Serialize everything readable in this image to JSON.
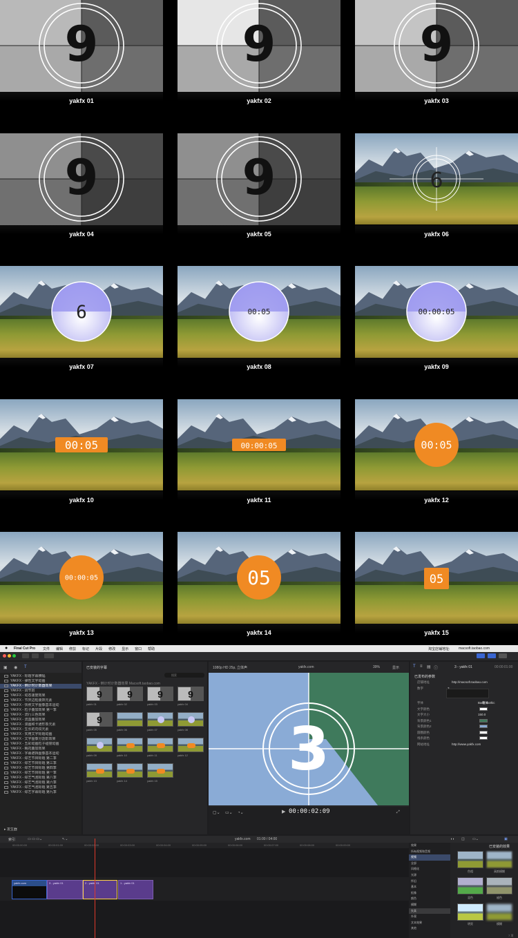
{
  "grid": {
    "items": [
      {
        "label": "yakfx 01",
        "digit": "9"
      },
      {
        "label": "yakfx 02",
        "digit": "9"
      },
      {
        "label": "yakfx 03",
        "digit": "9"
      },
      {
        "label": "yakfx 04",
        "digit": "9"
      },
      {
        "label": "yakfx 05",
        "digit": "9"
      },
      {
        "label": "yakfx 06",
        "digit": "6"
      },
      {
        "label": "yakfx 07",
        "digit": "6"
      },
      {
        "label": "yakfx 08",
        "digit": "00:05"
      },
      {
        "label": "yakfx 09",
        "digit": "00:00:05"
      },
      {
        "label": "yakfx 10",
        "digit": "00:05"
      },
      {
        "label": "yakfx 11",
        "digit": "00:00:05"
      },
      {
        "label": "yakfx 12",
        "digit": "00:05"
      },
      {
        "label": "yakfx 13",
        "digit": "00:00:05"
      },
      {
        "label": "yakfx 14",
        "digit": "05"
      },
      {
        "label": "yakfx 15",
        "digit": "05"
      }
    ]
  },
  "fcp": {
    "app_name": "Final Cut Pro",
    "menus": [
      "文件",
      "编辑",
      "修剪",
      "标记",
      "片段",
      "修改",
      "显示",
      "窗口",
      "帮助"
    ],
    "store_label": "淘宝店铺地址:",
    "store_url": "macsoft.taobao.com",
    "browser_header": "已安装的字幕",
    "search_placeholder": "搜索",
    "browser_group": "YAKFX - 倒计时计数器效果 Macsoft.taobao.com",
    "sidebar": [
      "YAKFX - 标题字幕横幅",
      "YAKFX - 弹性文字动画",
      "YAKFX - 倒计时计数器效果",
      "YAKFX - 调节层",
      "YAKFX - 动态速度效果",
      "YAKFX - 节庆边框装饰元素",
      "YAKFX - 快照文字图像基本运动",
      "YAKFX - 粒子叠加效果 第一季",
      "YAKFX - 流行三色效果",
      "YAKFX - 流血叠加效果",
      "YAKFX - 漫画和卡通形象元素",
      "YAKFX - 生长的花纹元素",
      "YAKFX - 实用文字标题动画",
      "YAKFX - 文字图像分割影效果",
      "YAKFX - 五彩动画粒子碰撞动画",
      "YAKFX - 糯花叠加效果",
      "YAKFX - 字幕遮挡图像基本运动",
      "YAKFX - 综艺节目标题 第二季",
      "YAKFX - 综艺节目标题 第三季",
      "YAKFX - 综艺节目标题 第四季",
      "YAKFX - 综艺节目标题 第一季",
      "YAKFX - 综艺气泡标题 第八季",
      "YAKFX - 综艺气泡标题 第六季",
      "YAKFX - 综艺气泡标题 第五季",
      "YAKFX - 综艺字幕标题 第九季"
    ],
    "sidebar_footer": "发生器",
    "browser_thumbs": [
      "yakfx 01",
      "yakfx 02",
      "yakfx 03",
      "yakfx 04",
      "yakfx 05",
      "yakfx 06",
      "yakfx 07",
      "yakfx 08",
      "yakfx 09",
      "yakfx 10",
      "yakfx 11",
      "yakfx 12",
      "yakfx 13",
      "yakfx 14",
      "yakfx 15"
    ],
    "viewer_format": "1080p HD 25p, 立体声",
    "viewer_project": "yakfx.com",
    "viewer_zoom": "39%",
    "viewer_display": "显示",
    "viewer_digit": "3",
    "timecode": "00:00:02:09",
    "inspector_title": "3 - yakfx 01",
    "inspector_time": "00:00:01:00",
    "inspector_section": "已发布的参数",
    "inspector_rows": [
      {
        "k": "店铺地址",
        "v": "http://macsoft.taobao.com"
      },
      {
        "k": "数字",
        "v": "3"
      },
      {
        "k": "字体",
        "v": "Bank Gothic"
      },
      {
        "k": "文字颜色",
        "v": ""
      },
      {
        "k": "文字大小",
        "v": "150.0"
      },
      {
        "k": "背景颜色1",
        "v": ""
      },
      {
        "k": "背景颜色2",
        "v": ""
      },
      {
        "k": "圆圈颜色",
        "v": ""
      },
      {
        "k": "线条颜色",
        "v": ""
      },
      {
        "k": "网站地址",
        "v": "http://www.yakfx.com"
      }
    ],
    "style_label": "粗体",
    "timeline_index": "索引",
    "timeline_project": "yakfx.com",
    "timeline_duration": "01:00 / 04:00",
    "ruler": [
      "00:00:00:00",
      "00:00:01:00",
      "00:00:02:00",
      "00:00:03:00",
      "00:00:04:00",
      "00:00:05:00",
      "00:00:06:00",
      "00:00:07:00",
      "00:00:08:00",
      "00:00:09:00"
    ],
    "clips": [
      {
        "label": "yakfx.com"
      },
      {
        "label": "3 - yakfx 01"
      },
      {
        "label": "2 - yakfx 01"
      },
      {
        "label": "1 - yakfx 01"
      }
    ],
    "effects_header": "已安装的效果",
    "effects_categories": [
      "效果",
      "所有视频和音频",
      "视频",
      "全部",
      "风格化",
      "光源",
      "怀旧",
      "基本",
      "抠像",
      "颜色",
      "模糊",
      "失真",
      "外观",
      "文本效果",
      "其他"
    ],
    "effects_thumbs": [
      {
        "label": "色相"
      },
      {
        "label": "高斯模糊"
      },
      {
        "label": "混色"
      },
      {
        "label": "褪色"
      },
      {
        "label": "明亮"
      },
      {
        "label": "模糊"
      }
    ],
    "effects_count": "7 项"
  },
  "colors": {
    "orange": "#f08a23",
    "violet_light": "#b6b3f2",
    "film_dark": "#3a3a3a",
    "clip_purple": "#5a3c8c",
    "viewer_blue": "#8aabd6",
    "viewer_green": "#3f7a5c"
  }
}
